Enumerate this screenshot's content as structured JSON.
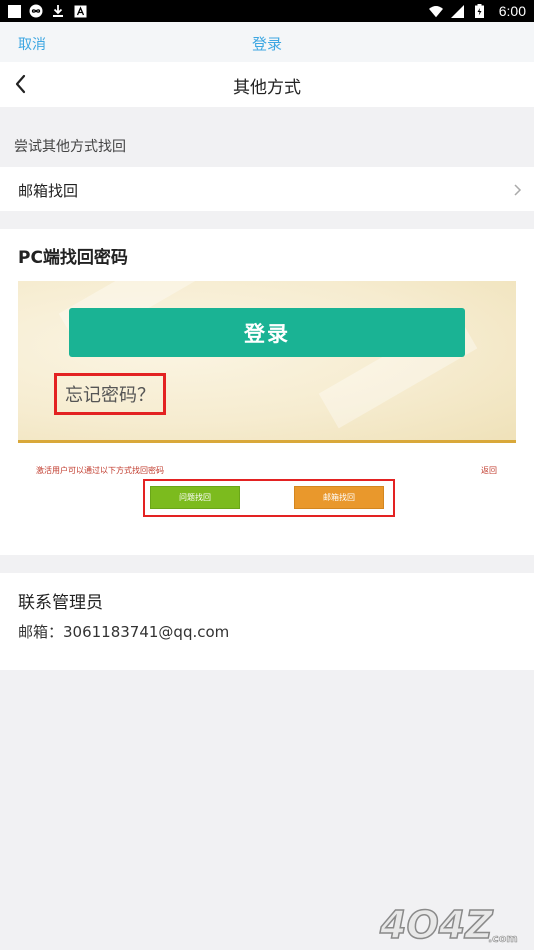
{
  "status_bar": {
    "time": "6:00"
  },
  "topbar": {
    "cancel": "取消",
    "title": "登录"
  },
  "navbar": {
    "title": "其他方式"
  },
  "section_hint": "尝试其他方式找回",
  "email_row": {
    "label": "邮箱找回"
  },
  "pc_section": {
    "title": "PC端找回密码",
    "screenshot": {
      "login_button": "登录",
      "forgot": "忘记密码？",
      "hint": "激活用户可以通过以下方式找回密码",
      "return": "返回",
      "question_button": "问题找回",
      "email_button": "邮箱找回"
    }
  },
  "contact": {
    "title": "联系管理员",
    "email": "邮箱：3061183741@qq.com"
  },
  "watermark": {
    "text": "4O4Z",
    "suffix": ".com"
  },
  "colors": {
    "accent": "#3ea7e2",
    "green": "#1ab394",
    "highlight": "#e32222"
  }
}
